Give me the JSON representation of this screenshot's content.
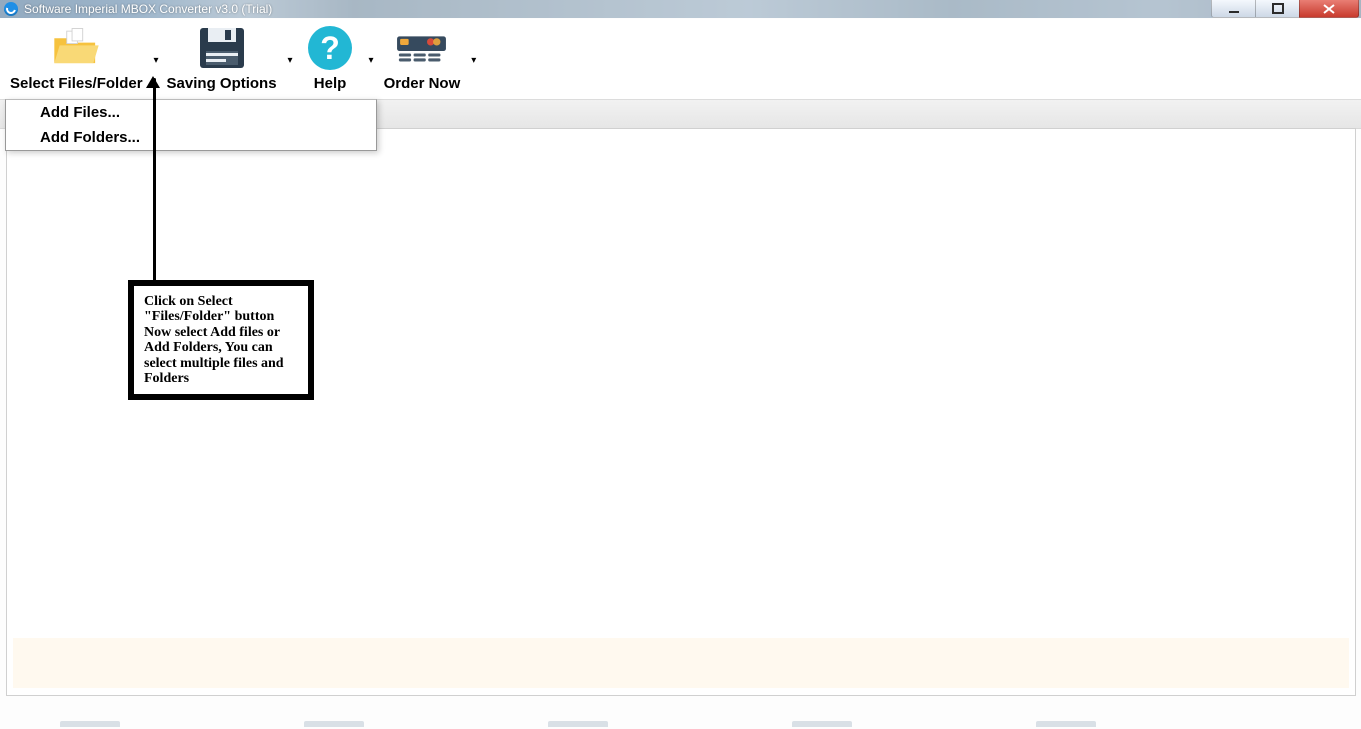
{
  "window": {
    "title": "Software Imperial MBOX Converter v3.0 (Trial)"
  },
  "toolbar": {
    "select_label": "Select Files/Folder",
    "saving_label": "Saving Options",
    "help_label": "Help",
    "order_label": "Order Now"
  },
  "dropdown": {
    "add_files": "Add Files...",
    "add_folders": "Add Folders..."
  },
  "annotation": {
    "text": "Click on Select \"Files/Folder\" button Now select Add files or Add Folders, You can select multiple files and Folders"
  }
}
